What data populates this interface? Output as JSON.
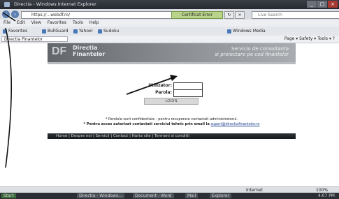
{
  "window": {
    "title": "Directia - Windows Internet Explorer",
    "buttons": [
      "_",
      "□",
      "×"
    ]
  },
  "address": {
    "url": "https://...webdf.ro/",
    "security": "Certificat Error",
    "search_placeholder": "Live Search"
  },
  "menu": [
    "File",
    "Edit",
    "View",
    "Favorites",
    "Tools",
    "Help"
  ],
  "favorites": {
    "label": "Favorites",
    "items": [
      "BullGuard",
      "Yahoo!",
      "Sudoku",
      "Windows Media"
    ]
  },
  "tab": {
    "label": "Directia Finantelor"
  },
  "commandbar": {
    "text": "Page ▾  Safety ▾  Tools ▾  ?"
  },
  "site": {
    "logo": "DF",
    "brand_line1": "Directia",
    "brand_line2": "Finantelor",
    "tagline_line1": "Serviciu de consultanta",
    "tagline_line2": "si proiectare pe cod finantelor"
  },
  "login": {
    "username_label": "Utilizator:",
    "password_label": "Parola:",
    "submit_label": "LOGIN"
  },
  "notes": {
    "line1": "* Parolele sunt confidentiale - pentru recuperare contactati administratorul.",
    "line2": "* Pentru acces autorizat contactati serviciul tehnic prin email la",
    "email": "suport@directiafinantelor.ro"
  },
  "footer": {
    "text": "Home | Despre noi | Servicii | Contact | Harta site | Termeni si conditii"
  },
  "status": {
    "zone": "Internet",
    "zoom": "100%"
  },
  "taskbar": {
    "start": "Start",
    "items": [
      "Directia - Windows...",
      "Document - Word",
      "Mail",
      "Explorer"
    ],
    "clock": "4:07 PM"
  }
}
